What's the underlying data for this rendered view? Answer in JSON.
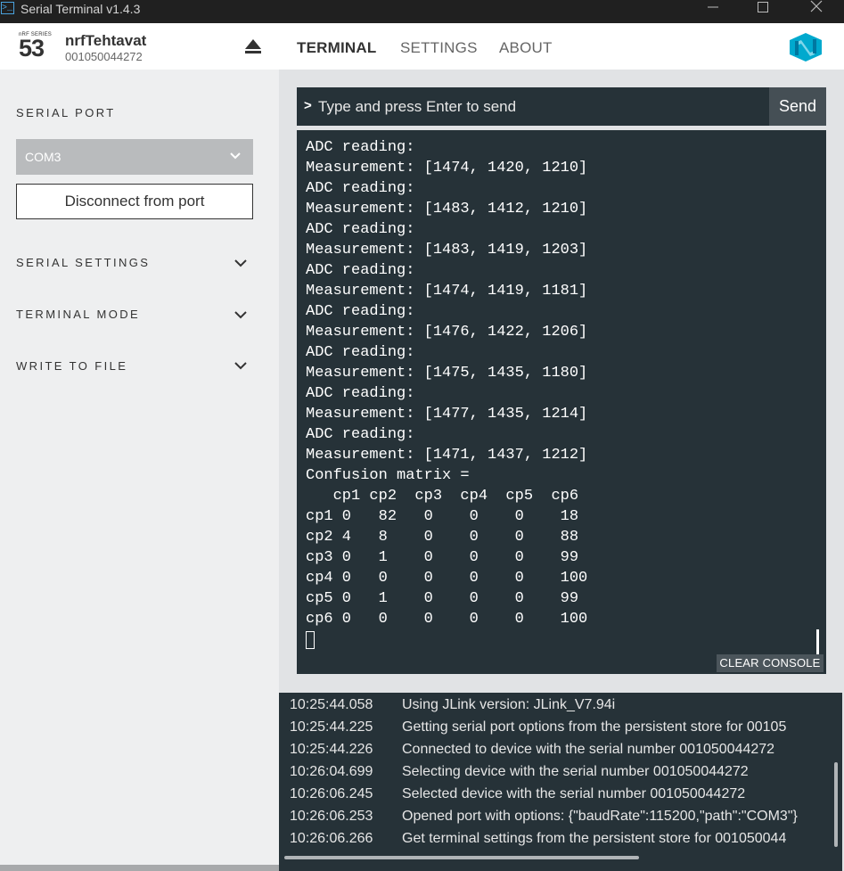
{
  "window": {
    "title": "Serial Terminal v1.4.3",
    "app_icon_glyph": ">_"
  },
  "header": {
    "logo_series": "nRF SERIES",
    "logo_number": "53",
    "device_name": "nrfTehtavat",
    "device_serial": "001050044272",
    "nav": {
      "terminal": "TERMINAL",
      "settings": "SETTINGS",
      "about": "ABOUT"
    },
    "active_tab": "TERMINAL"
  },
  "sidebar": {
    "serial_port_heading": "SERIAL PORT",
    "port_selected": "COM3",
    "disconnect_label": "Disconnect from port",
    "sections": [
      "SERIAL SETTINGS",
      "TERMINAL MODE",
      "WRITE TO FILE"
    ]
  },
  "terminal": {
    "prompt": ">",
    "input_placeholder": "Type and press Enter to send",
    "send_label": "Send",
    "lines": [
      "ADC reading:",
      "Measurement: [1474, 1420, 1210]",
      "ADC reading:",
      "Measurement: [1483, 1412, 1210]",
      "ADC reading:",
      "Measurement: [1483, 1419, 1203]",
      "ADC reading:",
      "Measurement: [1474, 1419, 1181]",
      "ADC reading:",
      "Measurement: [1476, 1422, 1206]",
      "ADC reading:",
      "Measurement: [1475, 1435, 1180]",
      "ADC reading:",
      "Measurement: [1477, 1435, 1214]",
      "ADC reading:",
      "Measurement: [1471, 1437, 1212]",
      "Confusion matrix =",
      "   cp1 cp2  cp3  cp4  cp5  cp6",
      "cp1 0   82   0    0    0    18",
      "cp2 4   8    0    0    0    88",
      "cp3 0   1    0    0    0    99",
      "cp4 0   0    0    0    0    100",
      "cp5 0   1    0    0    0    99",
      "cp6 0   0    0    0    0    100"
    ],
    "clear_label": "CLEAR CONSOLE"
  },
  "log": {
    "entries": [
      {
        "time": "10:25:44.058",
        "message": "Using JLink version: JLink_V7.94i"
      },
      {
        "time": "10:25:44.225",
        "message": "Getting serial port options from the persistent store for 00105"
      },
      {
        "time": "10:25:44.226",
        "message": "Connected to device with the serial number 001050044272"
      },
      {
        "time": "10:26:04.699",
        "message": "Selecting device with the serial number 001050044272"
      },
      {
        "time": "10:26:06.245",
        "message": "Selected device with the serial number 001050044272"
      },
      {
        "time": "10:26:06.253",
        "message": "Opened port with options: {\"baudRate\":115200,\"path\":\"COM3\"}"
      },
      {
        "time": "10:26:06.266",
        "message": "Get terminal settings from the persistent store for 001050044"
      }
    ]
  },
  "colors": {
    "terminal_bg": "#263238",
    "sidebar_bg": "#eeeff0",
    "main_bg": "#e1e3e5",
    "select_bg": "#b9bbbd",
    "brand_cyan": "#00a9ce"
  }
}
